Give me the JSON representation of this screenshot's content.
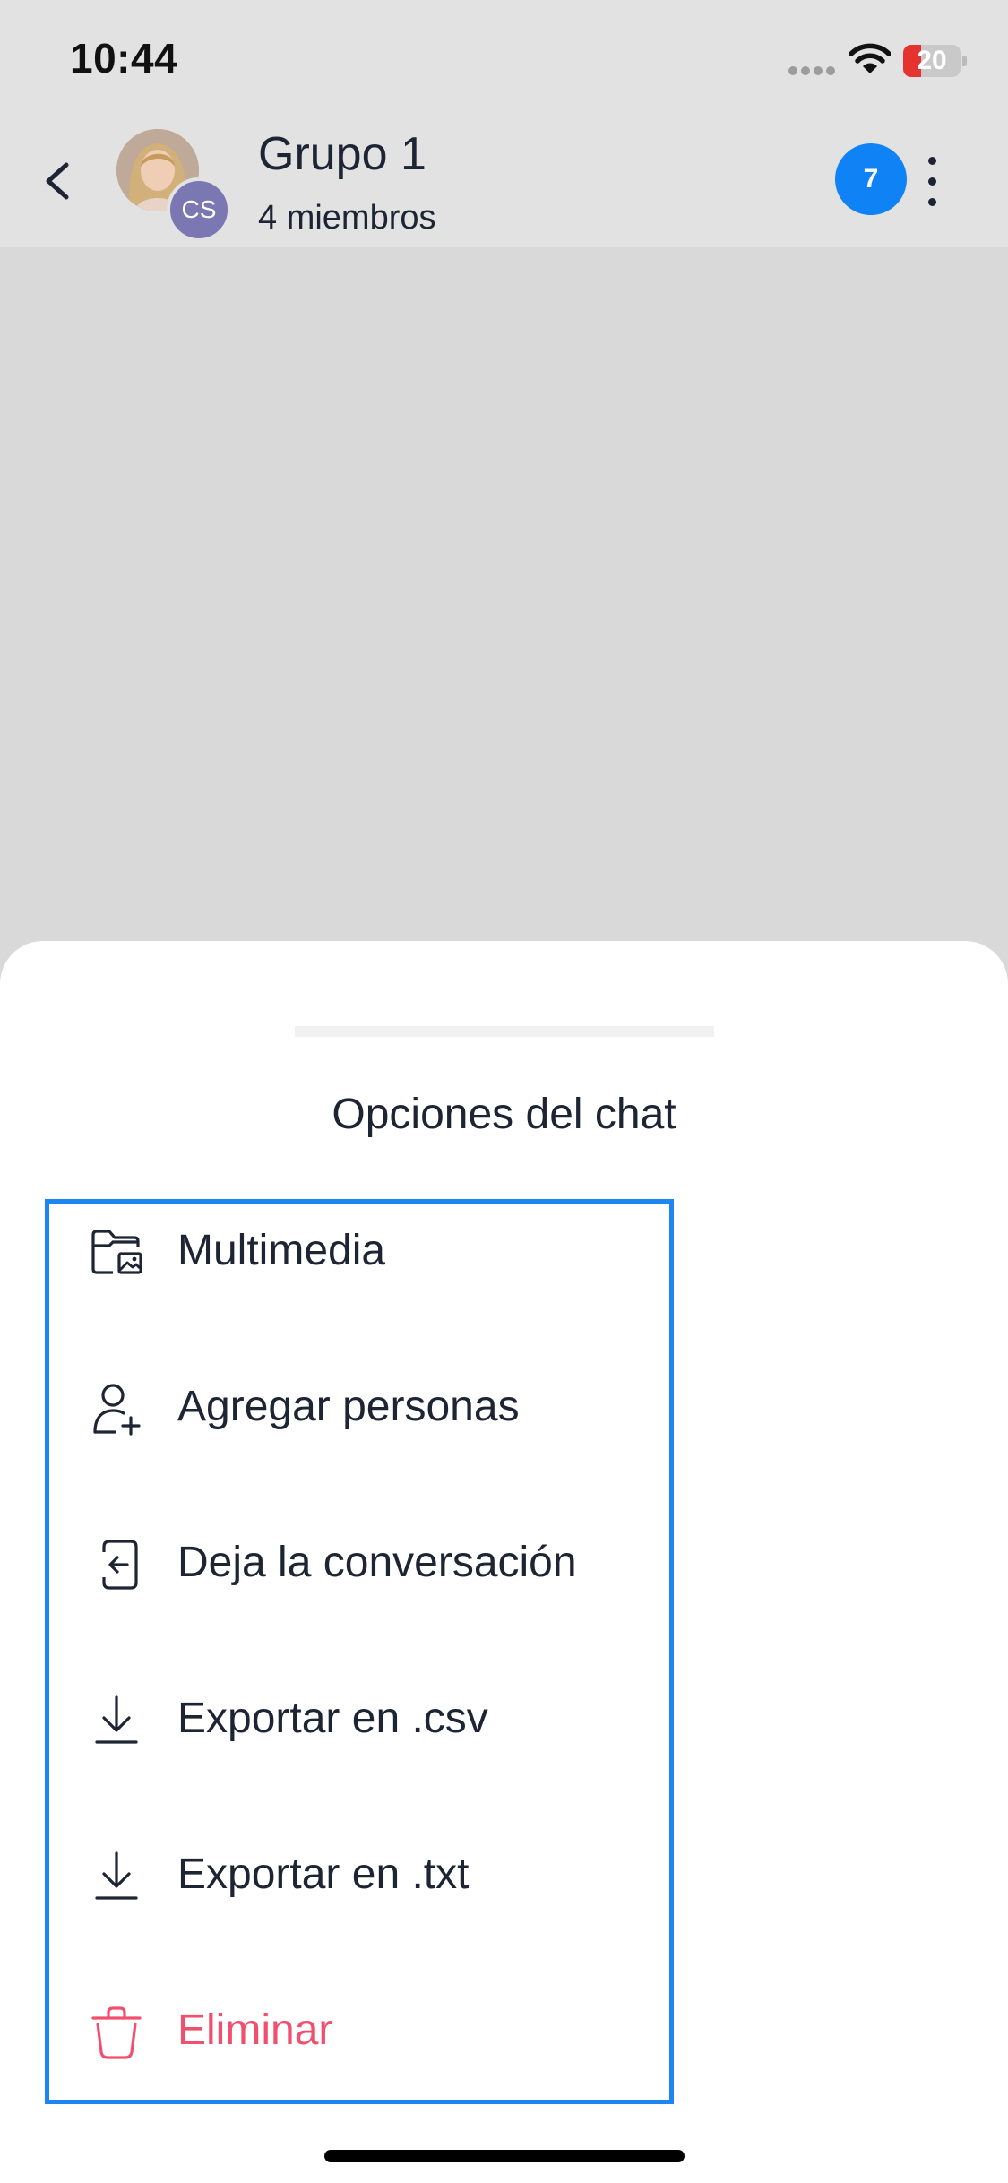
{
  "status_bar": {
    "time": "10:44",
    "battery_level": "20",
    "battery_fraction": 0.2,
    "icons": [
      "signal-dots-icon",
      "wifi-icon",
      "battery-icon"
    ]
  },
  "header": {
    "title": "Grupo 1",
    "subtitle": "4 miembros",
    "avatar_initials": "CS",
    "unread_count": "7",
    "icons": [
      "back-chevron-icon",
      "more-vertical-icon"
    ]
  },
  "sheet": {
    "title": "Opciones del chat",
    "options": [
      {
        "label": "Multimedia",
        "icon": "media-folder-icon"
      },
      {
        "label": "Agregar personas",
        "icon": "add-person-icon"
      },
      {
        "label": "Deja la conversación",
        "icon": "leave-conversation-icon"
      },
      {
        "label": "Exportar en .csv",
        "icon": "download-icon"
      },
      {
        "label": "Exportar en .txt",
        "icon": "download-icon"
      },
      {
        "label": "Eliminar",
        "icon": "trash-icon",
        "danger": true
      }
    ]
  },
  "colors": {
    "accent": "#0f82f5",
    "selection_outline": "#1c86f2",
    "danger": "#f0506e",
    "text": "#1d2433",
    "backdrop": "#d9d9d9"
  }
}
